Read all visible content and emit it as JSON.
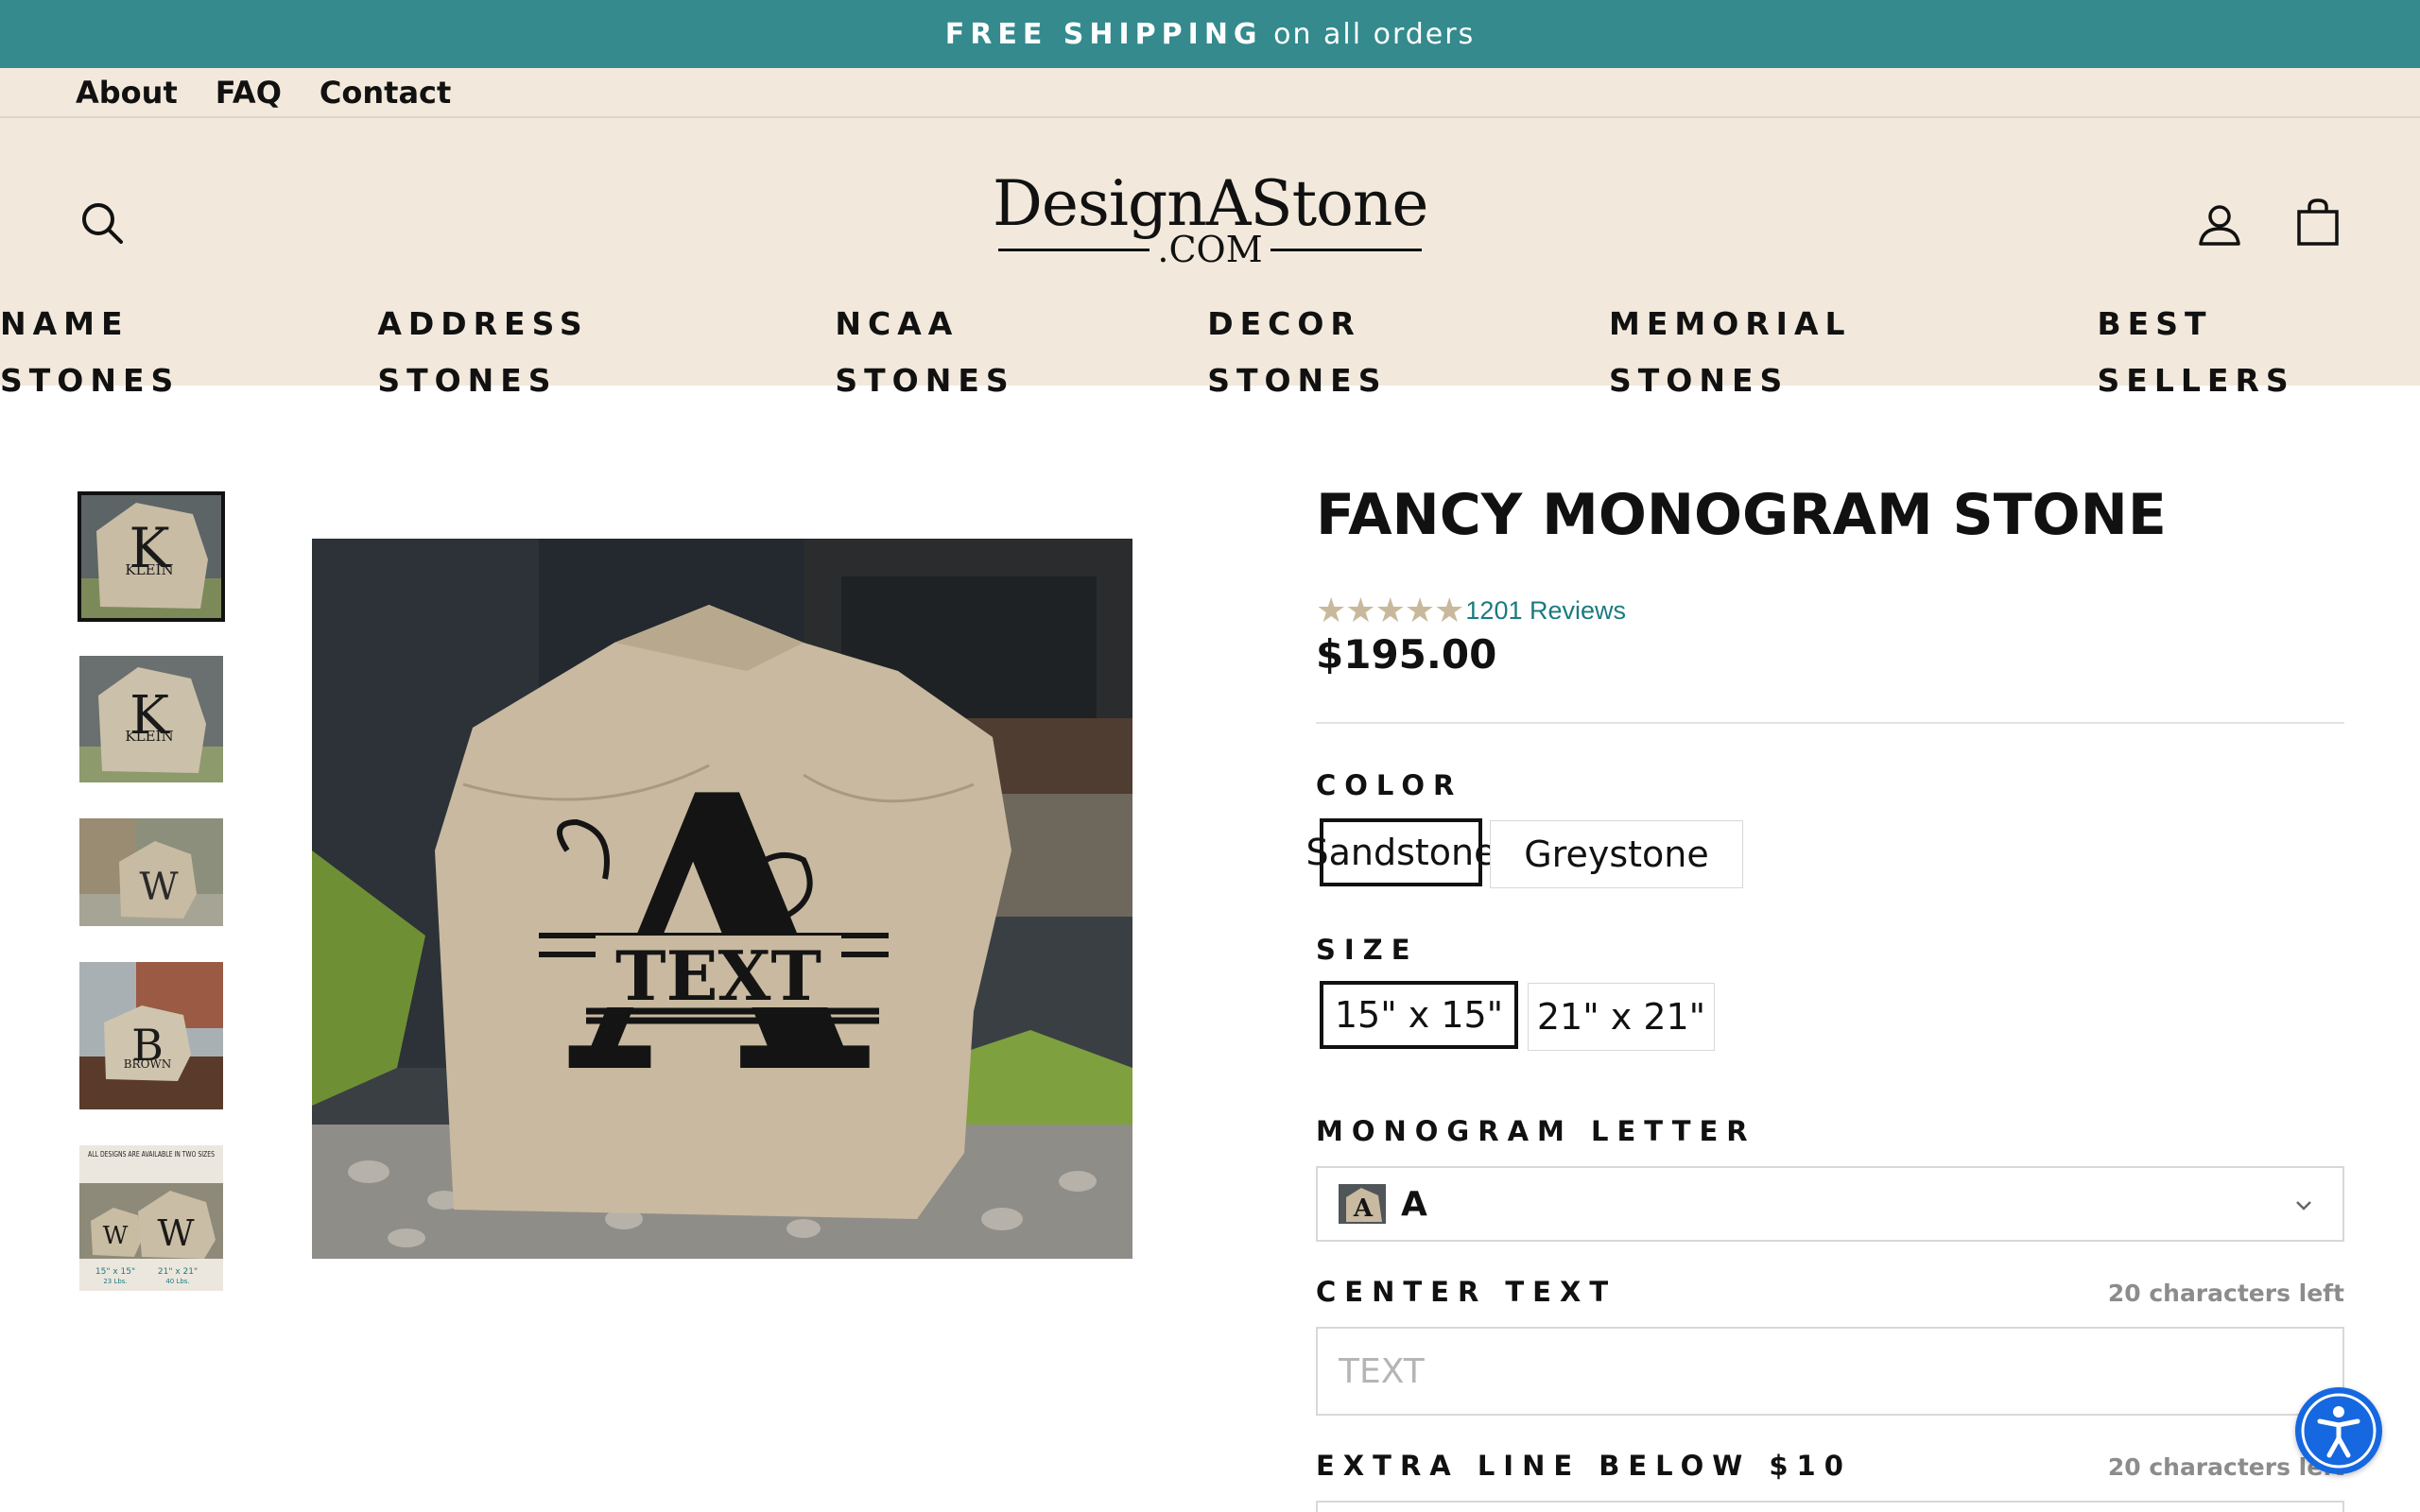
{
  "announcement": {
    "bold": "FREE SHIPPING",
    "rest": " on all orders"
  },
  "utility_nav": [
    "About",
    "FAQ",
    "Contact"
  ],
  "header": {
    "logo_main": "DesignAStone",
    "logo_sub": ".COM",
    "icons": {
      "search": "search-icon",
      "account": "user-icon",
      "cart": "shopping-bag-icon"
    }
  },
  "main_nav": [
    "NAME STONES",
    "ADDRESS STONES",
    "NCAA STONES",
    "DECOR STONES",
    "MEMORIAL STONES",
    "BEST SELLERS"
  ],
  "product": {
    "title": "FANCY MONOGRAM STONE",
    "rating": {
      "stars": 5,
      "reviews_label": "1201 Reviews"
    },
    "price": "$195.00",
    "image_stone_text": {
      "letter": "A",
      "center": "TEXT"
    },
    "thumb_text": {
      "t1_letter": "K",
      "t1_name": "KLEIN",
      "t2_letter": "K",
      "t2_name": "KLEIN",
      "t3_letter": "W",
      "t4_letter": "B",
      "t4_name": "BROWN",
      "t5_heading": "ALL DESIGNS ARE AVAILABLE IN TWO SIZES",
      "t5_size1": "15\" x 15\"",
      "t5_weight1": "23 Lbs.",
      "t5_size2": "21\" x 21\"",
      "t5_weight2": "40 Lbs."
    },
    "color": {
      "label": "COLOR",
      "options": [
        "Sandstone",
        "Greystone"
      ],
      "selected": "Sandstone"
    },
    "size": {
      "label": "SIZE",
      "options": [
        "15\" x 15\"",
        "21\" x 21\""
      ],
      "selected": "15\" x 15\""
    },
    "monogram": {
      "label": "MONOGRAM LETTER",
      "value": "A"
    },
    "center_text": {
      "label": "CENTER TEXT",
      "chars_left": "20 characters left",
      "placeholder": "TEXT"
    },
    "extra_line": {
      "label": "EXTRA LINE BELOW $10",
      "chars_left": "20 characters left"
    }
  },
  "colors": {
    "announcement_bg": "#348a8d",
    "header_bg": "#f2e9dc",
    "link": "#1b7b7f",
    "star": "#c9b99c",
    "a11y": "#1668e0"
  }
}
